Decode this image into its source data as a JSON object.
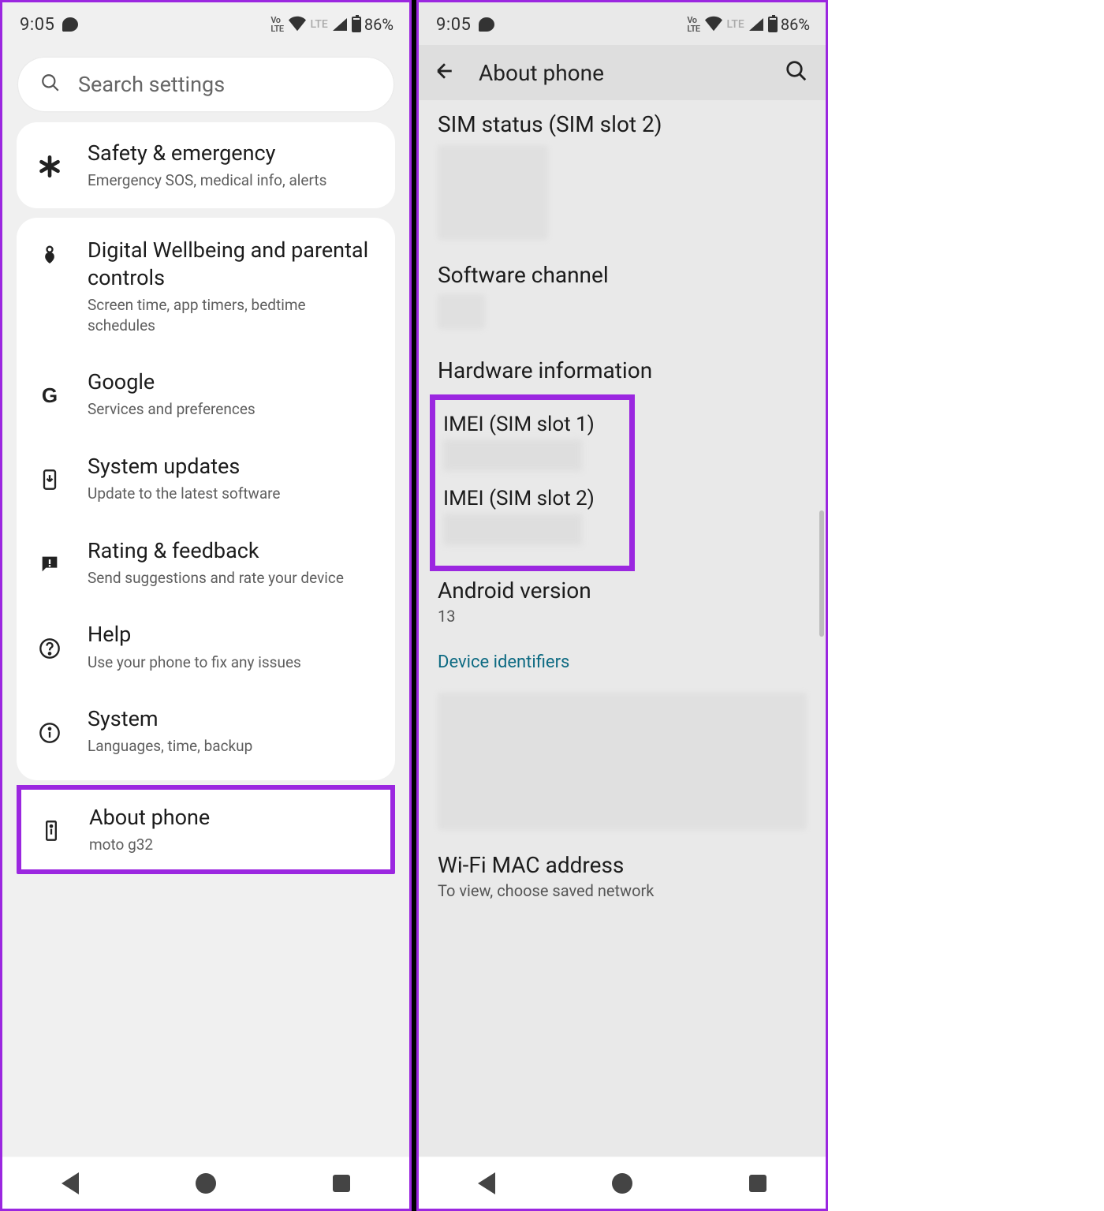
{
  "status": {
    "time": "9:05",
    "volte": "Vo LTE",
    "lte": "LTE",
    "battery_pct": "86%"
  },
  "left": {
    "search_placeholder": "Search settings",
    "safety": {
      "title": "Safety & emergency",
      "subtitle": "Emergency SOS, medical info, alerts"
    },
    "wellbeing": {
      "title": "Digital Wellbeing and parental controls",
      "subtitle": "Screen time, app timers, bedtime schedules"
    },
    "google": {
      "title": "Google",
      "subtitle": "Services and preferences"
    },
    "updates": {
      "title": "System updates",
      "subtitle": "Update to the latest software"
    },
    "rating": {
      "title": "Rating & feedback",
      "subtitle": "Send suggestions and rate your device"
    },
    "help": {
      "title": "Help",
      "subtitle": "Use your phone to fix any issues"
    },
    "system": {
      "title": "System",
      "subtitle": "Languages, time, backup"
    },
    "about": {
      "title": "About phone",
      "subtitle": "moto g32"
    }
  },
  "right": {
    "appbar_title": "About phone",
    "sim_status": "SIM status (SIM slot 2)",
    "software_channel": "Software channel",
    "hardware_info": "Hardware information",
    "imei1": "IMEI (SIM slot 1)",
    "imei2": "IMEI (SIM slot 2)",
    "android_version_label": "Android version",
    "android_version_value": "13",
    "device_identifiers": "Device identifiers",
    "wifi_mac_label": "Wi-Fi MAC address",
    "wifi_mac_value": "To view, choose saved network"
  }
}
